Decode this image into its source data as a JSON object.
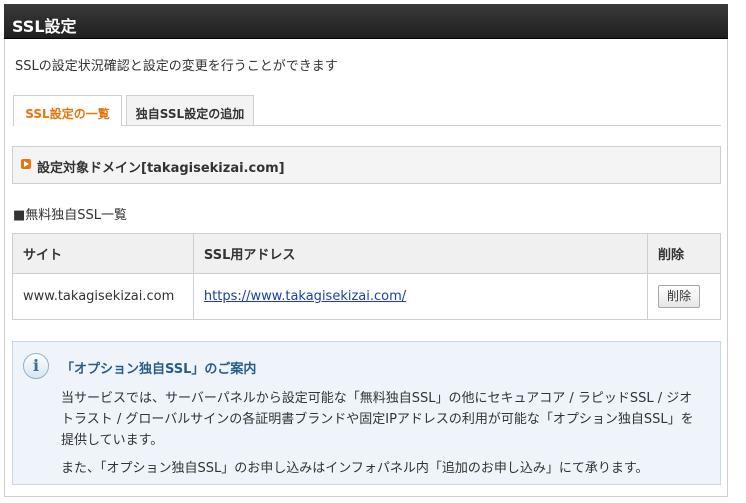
{
  "header": {
    "title": "SSL設定"
  },
  "description": "SSLの設定状況確認と設定の変更を行うことができます",
  "tabs": [
    {
      "label": "SSL設定の一覧",
      "active": true
    },
    {
      "label": "独自SSL設定の追加",
      "active": false
    }
  ],
  "domain_label": "設定対象ドメイン[takagisekizai.com]",
  "list_heading": "■無料独自SSL一覧",
  "table": {
    "headers": [
      "サイト",
      "SSL用アドレス",
      "削除"
    ],
    "rows": [
      {
        "site": "www.takagisekizai.com",
        "address": "https://www.takagisekizai.com/",
        "delete_label": "削除"
      }
    ]
  },
  "info": {
    "title": "「オプション独自SSL」のご案内",
    "paragraph1": "当サービスでは、サーバーパネルから設定可能な「無料独自SSL」の他にセキュアコア / ラピッドSSL / ジオトラスト / グローバルサインの各証明書ブランドや固定IPアドレスの利用が可能な「オプション独自SSL」を提供しています。",
    "paragraph2": "また、「オプション独自SSL」のお申し込みはインフォパネル内「追加のお申し込み」にて承ります。",
    "icon": "info-icon"
  },
  "colors": {
    "accent": "#e8740c",
    "link": "#1a3fa8",
    "info_title": "#2a5d8c"
  }
}
